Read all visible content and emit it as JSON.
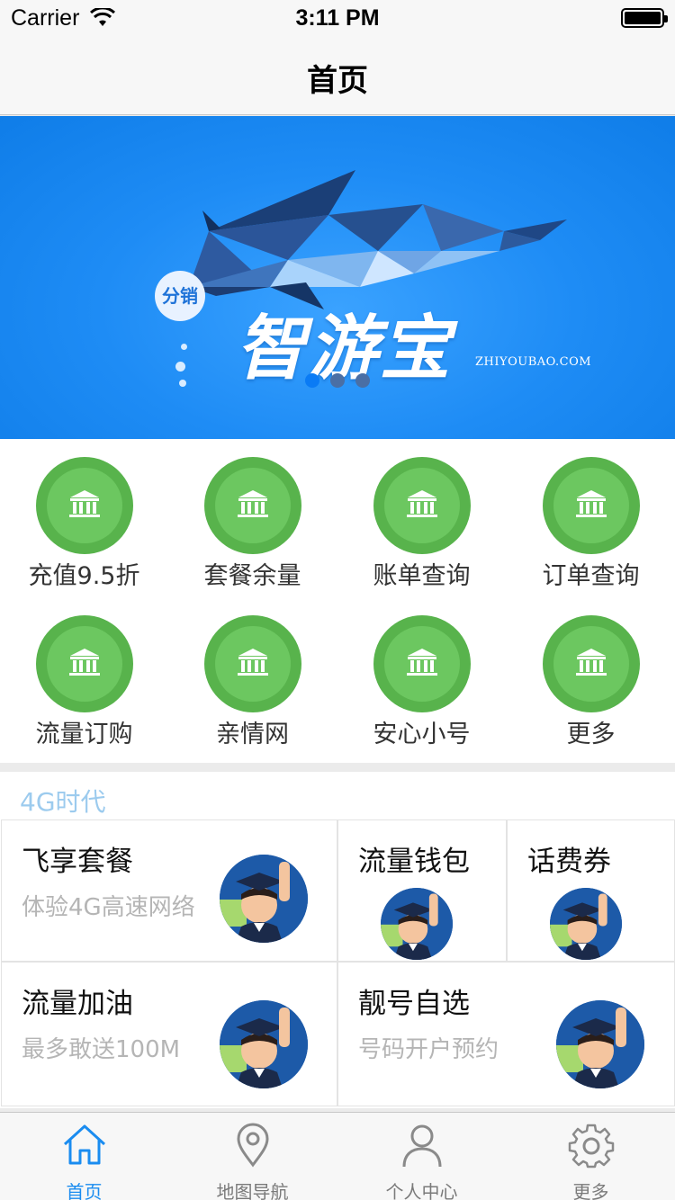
{
  "status_bar": {
    "carrier": "Carrier",
    "time": "3:11 PM"
  },
  "nav": {
    "title": "首页"
  },
  "banner": {
    "badge": "分销",
    "logo_text": "智游宝",
    "url": "ZHIYOUBAO.COM",
    "page_count": 3,
    "active_page": 1
  },
  "grid": {
    "icon": "building-icon",
    "items": [
      {
        "label": "充值9.5折"
      },
      {
        "label": "套餐余量"
      },
      {
        "label": "账单查询"
      },
      {
        "label": "订单查询"
      },
      {
        "label": "流量订购"
      },
      {
        "label": "亲情网"
      },
      {
        "label": "安心小号"
      },
      {
        "label": "更多"
      }
    ]
  },
  "section": {
    "title": "4G时代",
    "cards": [
      {
        "title": "飞享套餐",
        "subtitle": "体验4G高速网络"
      },
      {
        "title": "流量钱包",
        "subtitle": ""
      },
      {
        "title": "话费券",
        "subtitle": ""
      },
      {
        "title": "流量加油",
        "subtitle": "最多敢送100M"
      },
      {
        "title": "靓号自选",
        "subtitle": "号码开户预约"
      }
    ]
  },
  "tabs": [
    {
      "label": "首页",
      "icon": "home-icon",
      "active": true
    },
    {
      "label": "地图导航",
      "icon": "location-pin-icon",
      "active": false
    },
    {
      "label": "个人中心",
      "icon": "person-icon",
      "active": false
    },
    {
      "label": "更多",
      "icon": "gear-icon",
      "active": false
    }
  ],
  "colors": {
    "accent": "#1a8cf0",
    "banner_blue": "#1e8cf5",
    "grid_green": "#58b34c",
    "section_title": "#9ccbee"
  }
}
